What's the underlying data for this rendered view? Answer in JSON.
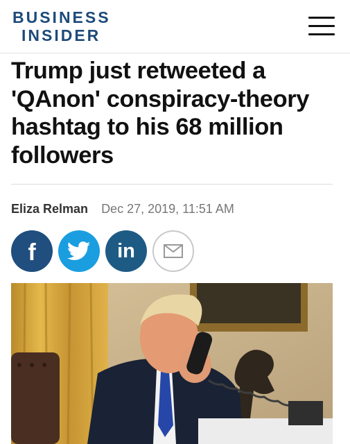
{
  "header": {
    "logo_line1": "BUSINESS",
    "logo_line2": "INSIDER",
    "brand_color": "#1e4a7a",
    "menu_icon": "hamburger-menu-icon"
  },
  "article": {
    "headline": "Trump just retweeted a 'QAnon' conspiracy-theory hashtag to his 68 million followers",
    "author": "Eliza Relman",
    "date": "Dec 27, 2019, 11:51 AM"
  },
  "share": {
    "buttons": [
      {
        "icon": "facebook-icon",
        "color": "#1f4e7f"
      },
      {
        "icon": "twitter-icon",
        "color": "#1a9ee0"
      },
      {
        "icon": "linkedin-icon",
        "color": "#1e5b84"
      },
      {
        "icon": "email-icon",
        "color": "#ffffff"
      }
    ],
    "linkedin_glyph": "in",
    "facebook_glyph": "f"
  },
  "image": {
    "alt_subject": "photo"
  }
}
